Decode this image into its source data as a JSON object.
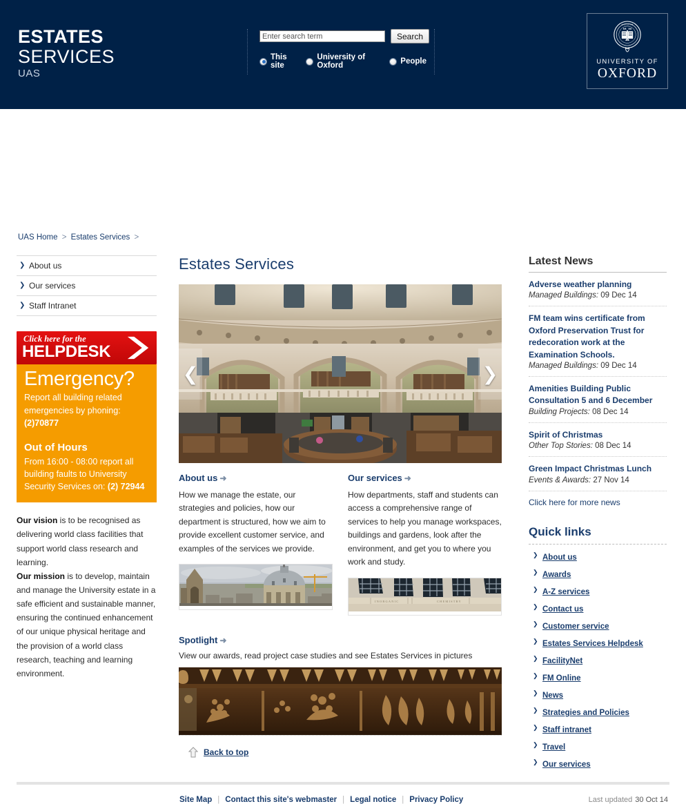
{
  "header": {
    "brand_line1": "ESTATES",
    "brand_line2": "SERVICES",
    "brand_line3": "UAS",
    "search": {
      "placeholder": "Enter search term",
      "value": "",
      "button_label": "Search",
      "scopes": [
        {
          "label": "This site",
          "selected": true
        },
        {
          "label": "University of Oxford",
          "selected": false
        },
        {
          "label": "People",
          "selected": false
        }
      ]
    },
    "logo": {
      "line1": "UNIVERSITY OF",
      "line2": "OXFORD",
      "icon": "oxford-crest-icon"
    },
    "bg_color": "#002147"
  },
  "breadcrumb": {
    "items": [
      "UAS Home",
      "Estates Services"
    ],
    "separator": ">"
  },
  "sidebar_left": {
    "nav_items": [
      {
        "label": "About us"
      },
      {
        "label": "Our services"
      },
      {
        "label": "Staff Intranet"
      }
    ],
    "helpdesk": {
      "small_label": "Click here for the",
      "big_label": "HELPDESK",
      "bg_color": "#d00b0b",
      "icon": "chevron-right-arrow-icon"
    },
    "emergency": {
      "heading": "Emergency?",
      "body": "Report all building related emergencies by phoning:",
      "phone": "(2)70877",
      "out_of_hours_heading": "Out of Hours",
      "out_of_hours_body": "From 16:00 - 08:00 report all building faults to University Security Services on:",
      "out_of_hours_phone": "(2) 72944",
      "bg_color": "#f59c00"
    },
    "vision_label": "Our vision",
    "vision_text": " is to be recognised as delivering world class facilities that support world class research and learning.",
    "mission_label": "Our mission",
    "mission_text": " is to develop, maintain and manage the University estate in a safe efficient and sustainable manner, ensuring the continued enhancement of our unique physical heritage and the provision of a world class research, teaching and learning environment."
  },
  "main": {
    "title": "Estates Services",
    "carousel": {
      "image_alt": "radcliffe-camera-reading-room-photo",
      "prev_icon": "chevron-left-icon",
      "next_icon": "chevron-right-icon"
    },
    "promo_left": {
      "heading": "About us",
      "arrow": "➜",
      "body": "How we manage the estate, our strategies and policies, how our department is structured, how we aim to provide excellent customer service, and examples of the services we provide.",
      "image_alt": "oxford-skyline-radcliffe-camera-photo"
    },
    "promo_right": {
      "heading": "Our services",
      "arrow": "➜",
      "body": "How departments, staff and students can access a comprehensive range of services to help you manage workspaces, buildings and gardens, look after the environment, and get you to where you work and study.",
      "image_alt": "inorganic-chemistry-building-facade-photo"
    },
    "spotlight": {
      "heading": "Spotlight",
      "arrow": "➜",
      "body": "View our awards, read project case studies and see Estates Services in pictures",
      "image_alt": "carved-wood-detail-photo"
    },
    "back_to_top": {
      "label": "Back to top",
      "icon": "up-arrow-icon"
    }
  },
  "sidebar_right": {
    "news_heading": "Latest News",
    "news_items": [
      {
        "title": "Adverse weather planning",
        "category": "Managed Buildings:",
        "date": "09 Dec 14"
      },
      {
        "title": "FM team wins certificate from Oxford Preservation Trust for redecoration work at the Examination Schools.",
        "category": "Managed Buildings:",
        "date": "09 Dec 14"
      },
      {
        "title": "Amenities Building Public Consultation 5 and 6 December",
        "category": "Building Projects:",
        "date": "08 Dec 14"
      },
      {
        "title": "Spirit of Christmas",
        "category": "Other Top Stories:",
        "date": "08 Dec 14"
      },
      {
        "title": "Green Impact Christmas Lunch",
        "category": "Events & Awards:",
        "date": "27 Nov 14"
      }
    ],
    "more_news_label": "Click here for more news",
    "quick_links_heading": "Quick links",
    "quick_links": [
      {
        "label": "About us"
      },
      {
        "label": "Awards"
      },
      {
        "label": "A-Z services"
      },
      {
        "label": "Contact us"
      },
      {
        "label": "Customer service"
      },
      {
        "label": "Estates Services Helpdesk"
      },
      {
        "label": "FacilityNet"
      },
      {
        "label": "FM Online"
      },
      {
        "label": "News"
      },
      {
        "label": "Strategies and Policies"
      },
      {
        "label": "Staff intranet"
      },
      {
        "label": "Travel"
      },
      {
        "label": "Our services"
      }
    ]
  },
  "footer": {
    "links": [
      "Site Map",
      "Contact this site's webmaster",
      "Legal notice",
      "Privacy Policy"
    ],
    "updated_label": "Last updated",
    "updated_date": "30 Oct 14"
  },
  "colors": {
    "oxford_blue": "#002147",
    "link_blue": "#1a3d6d",
    "emergency_orange": "#f59c00",
    "helpdesk_red": "#d00b0b"
  }
}
